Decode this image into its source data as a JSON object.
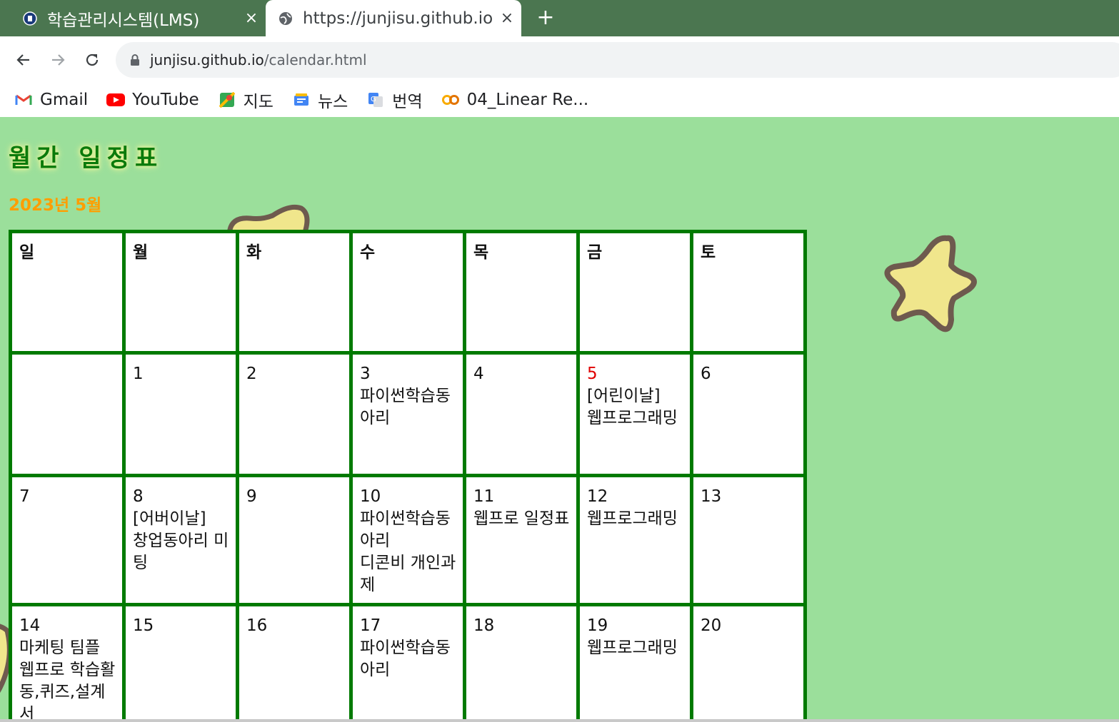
{
  "browser": {
    "tabs": [
      {
        "title": "학습관리시스템(LMS)",
        "close": "×"
      },
      {
        "title": "https://junjisu.github.io",
        "close": "×"
      }
    ],
    "new_tab": "+",
    "url_host": "junjisu.github.io",
    "url_path": "/calendar.html",
    "bookmarks": [
      {
        "label": "Gmail",
        "icon": "gmail-icon"
      },
      {
        "label": "YouTube",
        "icon": "youtube-icon"
      },
      {
        "label": "지도",
        "icon": "maps-icon"
      },
      {
        "label": "뉴스",
        "icon": "news-icon"
      },
      {
        "label": "번역",
        "icon": "translate-icon"
      },
      {
        "label": "04_Linear Re...",
        "icon": "colab-icon"
      }
    ]
  },
  "page": {
    "title": "월간 일정표",
    "subtitle": "2023년 5월",
    "colors": {
      "background": "#9bdf9b",
      "border": "#007a00",
      "title": "#0a7a0a",
      "subtitle": "#ff9e00",
      "sunday": "#e00000",
      "saturday": "#0000d0"
    }
  },
  "calendar": {
    "weekdays": [
      "일",
      "월",
      "화",
      "수",
      "목",
      "금",
      "토"
    ],
    "weeks": [
      [
        {
          "day": "",
          "events": ""
        },
        {
          "day": "1",
          "events": ""
        },
        {
          "day": "2",
          "events": ""
        },
        {
          "day": "3",
          "events": "파이썬학습동아리"
        },
        {
          "day": "4",
          "events": ""
        },
        {
          "day": "5",
          "events": "[어린이날]\n웹프로그래밍"
        },
        {
          "day": "6",
          "events": ""
        }
      ],
      [
        {
          "day": "7",
          "events": ""
        },
        {
          "day": "8",
          "events": "[어버이날]\n창업동아리 미팅"
        },
        {
          "day": "9",
          "events": ""
        },
        {
          "day": "10",
          "events": "파이썬학습동아리\n디콘비 개인과제"
        },
        {
          "day": "11",
          "events": "웹프로 일정표"
        },
        {
          "day": "12",
          "events": "웹프로그래밍"
        },
        {
          "day": "13",
          "events": ""
        }
      ],
      [
        {
          "day": "14",
          "events": "마케팅 팀플\n웹프로 학습활동,퀴즈,설계서"
        },
        {
          "day": "15",
          "events": ""
        },
        {
          "day": "16",
          "events": ""
        },
        {
          "day": "17",
          "events": "파이썬학습동아리"
        },
        {
          "day": "18",
          "events": ""
        },
        {
          "day": "19",
          "events": "웹프로그래밍"
        },
        {
          "day": "20",
          "events": ""
        }
      ]
    ]
  }
}
